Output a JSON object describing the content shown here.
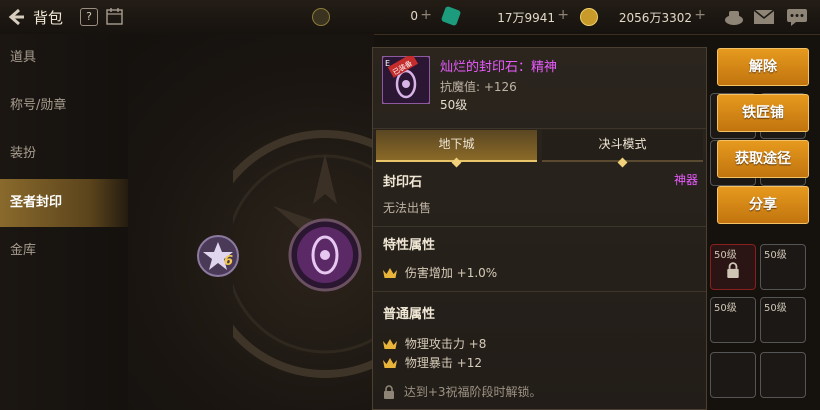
{
  "topbar": {
    "back_icon": "back-arrow-icon",
    "title": "背包",
    "help_label": "?",
    "calendar_icon": "calendar-icon",
    "currencies": [
      {
        "icon": "coin-c-icon",
        "value": "0",
        "plus": "+",
        "color": "#8c7a3a"
      },
      {
        "icon": "green-gem-icon",
        "value": "17万9941",
        "plus": "+",
        "color": "#1c9c7c"
      },
      {
        "icon": "gold-coin-icon",
        "value": "2056万3302",
        "plus": "+",
        "color": "#c79a2a"
      }
    ],
    "right_icons": [
      "box-icon",
      "mail-icon",
      "chat-icon"
    ]
  },
  "sidenav": {
    "items": [
      {
        "label": "道具",
        "active": false
      },
      {
        "label": "称号/勋章",
        "active": false
      },
      {
        "label": "装扮",
        "active": false
      },
      {
        "label": "圣者封印",
        "active": true
      },
      {
        "label": "金库",
        "active": false
      }
    ]
  },
  "scene": {
    "small_gem_badge": "6"
  },
  "tooltip": {
    "icon_badge": "已装备",
    "icon_corner": "E",
    "name": "灿烂的封印石：精神",
    "stat": "抗魔值: +126",
    "level": "50级",
    "tabs": [
      {
        "label": "地下城",
        "active": true
      },
      {
        "label": "决斗模式",
        "active": false
      }
    ],
    "type_label": "封印石",
    "type_rarity": "神器",
    "trade_note": "无法出售",
    "special_title": "特性属性",
    "special_attrs": [
      "伤害增加 +1.0%"
    ],
    "normal_title": "普通属性",
    "normal_attrs": [
      "物理攻击力 +8",
      "物理暴击 +12"
    ],
    "unlock_note": "达到+3祝福阶段时解锁。"
  },
  "actions": [
    "解除",
    "铁匠铺",
    "获取途径",
    "分享"
  ],
  "grid": {
    "slots": [
      {
        "label": "50级",
        "red": false,
        "locked": false
      },
      {
        "label": "50级",
        "red": true,
        "locked": true
      },
      {
        "label": "50级",
        "red": false,
        "locked": false
      },
      {
        "label": "50级",
        "red": false,
        "locked": false
      }
    ]
  },
  "colors": {
    "accent_gold": "#e8a32a",
    "artifact_purple": "#e95bff",
    "active_nav": "#8a6a2c"
  }
}
